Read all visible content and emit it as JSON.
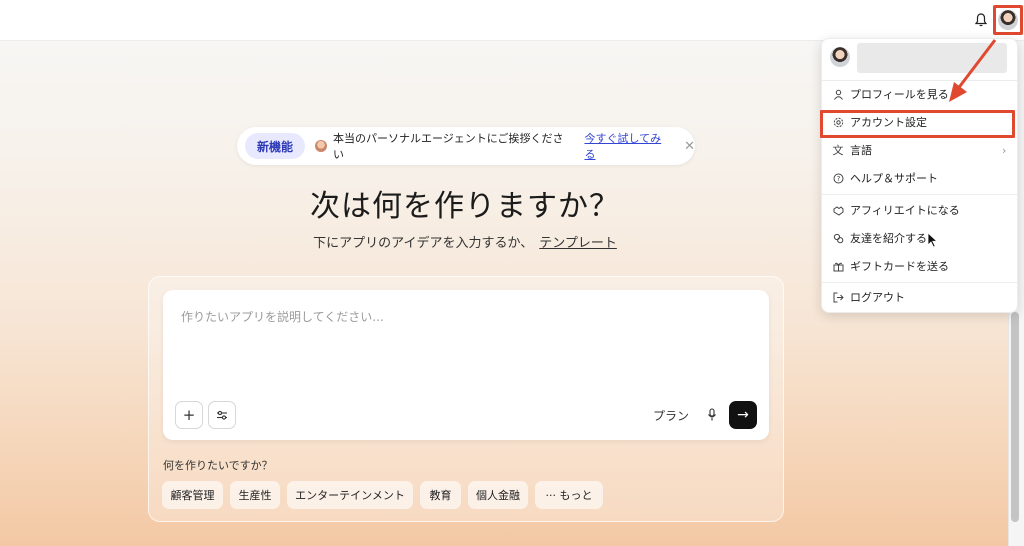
{
  "colors": {
    "accent": "#e0492f",
    "link": "#3346d3",
    "badge_bg": "#e8e9ff",
    "badge_text": "#2f3bb5",
    "send_bg": "#111111"
  },
  "topbar": {
    "bell_icon": "bell-icon",
    "avatar_icon": "user-avatar"
  },
  "announcement": {
    "badge": "新機能",
    "text": "本当のパーソナルエージェントにご挨拶ください",
    "link": "今すぐ試してみる",
    "close": "✕"
  },
  "hero": {
    "title": "次は何を作りますか？",
    "subtitle": "下にアプリのアイデアを入力するか、",
    "template_link": "テンプレート"
  },
  "composer": {
    "placeholder": "作りたいアプリを説明してください...",
    "add_icon": "plus-icon",
    "settings_icon": "sliders-icon",
    "plan_label": "プラン",
    "mic_icon": "microphone-icon",
    "send_icon": "arrow-right-icon"
  },
  "suggestions": {
    "question": "何を作りたいですか？",
    "chips": [
      "顧客管理",
      "生産性",
      "エンターテインメント",
      "教育",
      "個人金融",
      "··· もっと"
    ]
  },
  "account_menu": {
    "items": [
      {
        "icon": "person-icon",
        "label": "プロフィールを見る"
      },
      {
        "icon": "gear-icon",
        "label": "アカウント設定"
      },
      {
        "icon": "translate-icon",
        "label": "言語",
        "chevron": "›"
      },
      {
        "icon": "help-circle-icon",
        "label": "ヘルプ＆サポート"
      },
      {
        "icon": "handshake-icon",
        "label": "アフィリエイトになる"
      },
      {
        "icon": "invite-icon",
        "label": "友達を紹介する"
      },
      {
        "icon": "gift-icon",
        "label": "ギフトカードを送る"
      },
      {
        "icon": "logout-icon",
        "label": "ログアウト"
      }
    ]
  }
}
